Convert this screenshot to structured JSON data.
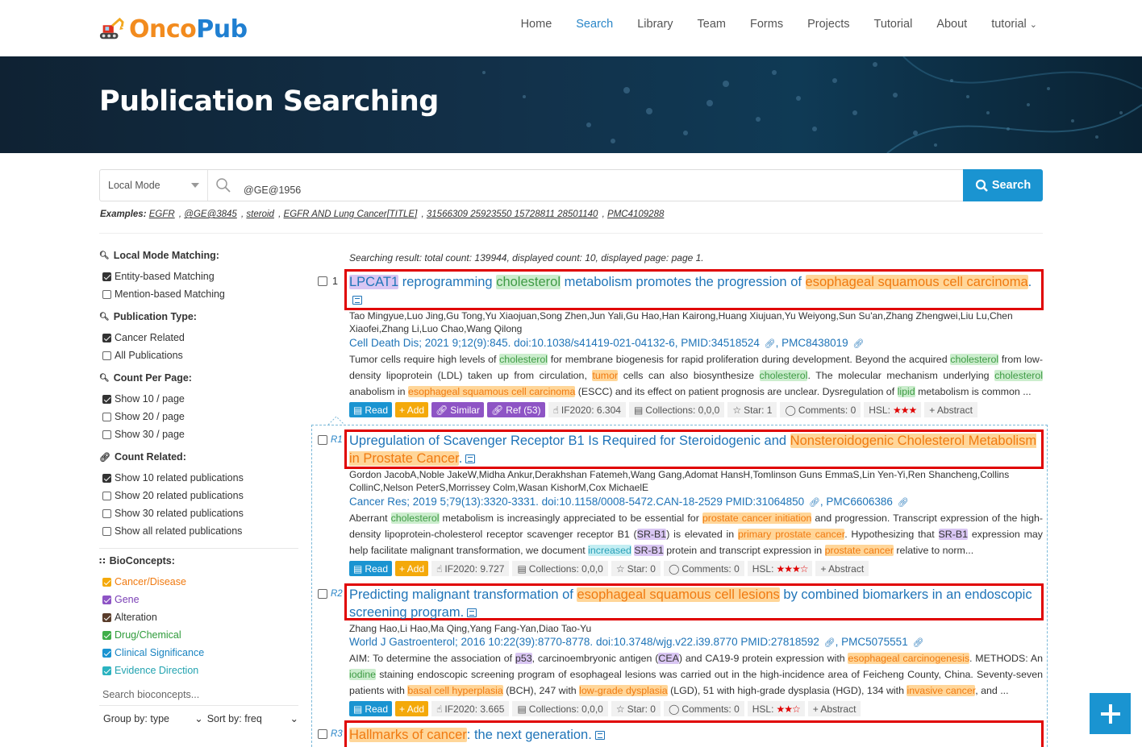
{
  "brand": {
    "part1": "Onco",
    "part2": "Pub"
  },
  "nav": [
    "Home",
    "Search",
    "Library",
    "Team",
    "Forms",
    "Projects",
    "Tutorial",
    "About",
    "tutorial"
  ],
  "hero_title": "Publication Searching",
  "search": {
    "mode": "Local Mode",
    "query": "@GE@1956",
    "button": "Search"
  },
  "examples": {
    "label": "Examples:",
    "items": [
      "EGFR",
      "@GE@3845",
      "steroid",
      "EGFR AND Lung Cancer[TITLE]",
      "31566309 25923550 15728811 28501140",
      "PMC4109288"
    ]
  },
  "sidebar": {
    "local_mode": {
      "title": "Local Mode Matching:",
      "options": [
        {
          "label": "Entity-based Matching",
          "checked": true
        },
        {
          "label": "Mention-based Matching",
          "checked": false
        }
      ]
    },
    "pub_type": {
      "title": "Publication Type:",
      "options": [
        {
          "label": "Cancer Related",
          "checked": true
        },
        {
          "label": "All Publications",
          "checked": false
        }
      ]
    },
    "count_page": {
      "title": "Count Per Page:",
      "options": [
        {
          "label": "Show 10 / page",
          "checked": true
        },
        {
          "label": "Show 20 / page",
          "checked": false
        },
        {
          "label": "Show 30 / page",
          "checked": false
        }
      ]
    },
    "count_related": {
      "title": "Count Related:",
      "options": [
        {
          "label": "Show 10 related publications",
          "checked": true
        },
        {
          "label": "Show 20 related publications",
          "checked": false
        },
        {
          "label": "Show 30 related publications",
          "checked": false
        },
        {
          "label": "Show all related publications",
          "checked": false
        }
      ]
    },
    "bioconcepts": {
      "title": "BioConcepts:",
      "items": [
        {
          "label": "Cancer/Disease",
          "color": "#f4a90a"
        },
        {
          "label": "Gene",
          "color": "#8e54c5"
        },
        {
          "label": "Alteration",
          "color": "#5a3d2b"
        },
        {
          "label": "Drug/Chemical",
          "color": "#3fae49"
        },
        {
          "label": "Clinical Significance",
          "color": "#1a94d1"
        },
        {
          "label": "Evidence Direction",
          "color": "#2bb3c0"
        }
      ]
    },
    "search_placeholder": "Search bioconcepts...",
    "group_by": "Group by: type",
    "sort_by": "Sort by: freq"
  },
  "status": "Searching result: total count: 139944, displayed count: 10, displayed page: page 1.",
  "results": [
    {
      "num": "1",
      "authors": "Tao Mingyue,Luo Jing,Gu Tong,Yu Xiaojuan,Song Zhen,Jun Yali,Gu Hao,Han Kairong,Huang Xiujuan,Yu Weiyong,Sun Su'an,Zhang Zhengwei,Liu Lu,Chen Xiaofei,Zhang Li,Luo Chao,Wang Qilong",
      "journal": "Cell Death Dis; 2021 9;12(9):845. doi:10.1038/s41419-021-04132-6, PMID:34518524",
      "pmc": ", PMC8438019",
      "metrics": {
        "if": "IF2020: 6.304",
        "collections": "Collections: 0,0,0",
        "star": "Star: 1",
        "comments": "Comments: 0",
        "hsl": "HSL:",
        "stars": "★★★"
      }
    },
    {
      "num": "R1",
      "authors": "Gordon JacobA,Noble JakeW,Midha Ankur,Derakhshan Fatemeh,Wang Gang,Adomat HansH,Tomlinson Guns EmmaS,Lin Yen-Yi,Ren Shancheng,Collins CollinC,Nelson PeterS,Morrissey Colm,Wasan KishorM,Cox MichaelE",
      "journal": "Cancer Res; 2019 5;79(13):3320-3331. doi:10.1158/0008-5472.CAN-18-2529 PMID:31064850",
      "pmc": ", PMC6606386",
      "metrics": {
        "if": "IF2020: 9.727",
        "collections": "Collections: 0,0,0",
        "star": "Star: 0",
        "comments": "Comments: 0",
        "hsl": "HSL:",
        "stars": "★★★☆"
      }
    },
    {
      "num": "R2",
      "authors": "Zhang Hao,Li Hao,Ma Qing,Yang Fang-Yan,Diao Tao-Yu",
      "journal": "World J Gastroenterol; 2016 10:22(39):8770-8778. doi:10.3748/wjg.v22.i39.8770 PMID:27818592",
      "pmc": ", PMC5075551",
      "metrics": {
        "if": "IF2020: 3.665",
        "collections": "Collections: 0,0,0",
        "star": "Star: 0",
        "comments": "Comments: 0",
        "hsl": "HSL:",
        "stars": "★★☆"
      }
    },
    {
      "num": "R3"
    }
  ],
  "buttons": {
    "read": "Read",
    "add": "+ Add",
    "similar": "Similar",
    "ref": "Ref (53)",
    "abstract": "+ Abstract"
  },
  "texts": {
    "t1": [
      "LPCAT1",
      " reprogramming ",
      "cholesterol",
      " metabolism promotes the progression of ",
      "esophageal squamous cell carcinoma",
      "."
    ],
    "a1": [
      "Tumor cells require high levels of ",
      "cholesterol",
      " for membrane biogenesis for rapid proliferation during development. Beyond the acquired ",
      "cholesterol",
      " from low-density lipoprotein (LDL) taken up from circulation, ",
      "tumor",
      " cells can also biosynthesize ",
      "cholesterol",
      ". The molecular mechanism underlying ",
      "cholesterol",
      " anabolism in ",
      "esophageal squamous cell carcinoma",
      " (ESCC) and its effect on patient prognosis are unclear. Dysregulation of ",
      "lipid",
      " metabolism is common ..."
    ],
    "t2": [
      "Upregulation of Scavenger Receptor B1 Is Required for Steroidogenic and ",
      "Nonsteroidogenic Cholesterol Metabolism in Prostate Cancer",
      "."
    ],
    "a2": [
      "Aberrant ",
      "cholesterol",
      " metabolism is increasingly appreciated to be essential for ",
      "prostate cancer initiation",
      " and progression. Transcript expression of the high-density lipoprotein-cholesterol receptor scavenger receptor B1 (",
      "SR-B1",
      ") is elevated in ",
      "primary prostate cancer",
      ". Hypothesizing that ",
      "SR-B1",
      " expression may help facilitate malignant transformation, we document ",
      "increased",
      " ",
      "SR-B1",
      " protein and transcript expression in ",
      "prostate cancer",
      " relative to norm..."
    ],
    "t3": [
      "Predicting malignant transformation of ",
      "esophageal squamous cell lesions",
      " by combined biomarkers in an endoscopic screening program."
    ],
    "a3": [
      "AIM: To determine the association of ",
      "p53",
      ", carcinoembryonic antigen (",
      "CEA",
      ") and CA19-9 protein expression with ",
      "esophageal carcinogenesis",
      ". METHODS: An ",
      "iodine",
      " staining endoscopic screening program of esophageal lesions was carried out in the high-incidence area of Feicheng County, China. Seventy-seven patients with ",
      "basal cell hyperplasia",
      " (BCH), 247 with ",
      "low-grade dysplasia",
      " (LGD), 51 with high-grade dysplasia (HGD), 134 with ",
      "invasive cancer",
      ", and ..."
    ],
    "t4": [
      "Hallmarks of cancer",
      ": the next generation."
    ]
  }
}
